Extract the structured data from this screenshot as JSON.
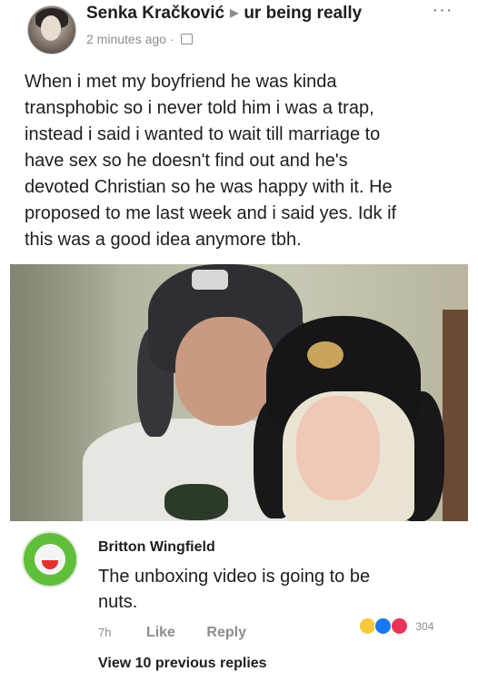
{
  "post": {
    "author": "Senka Kračković",
    "group": "ur being really",
    "time": "2 minutes ago",
    "more": "···",
    "text_lines": [
      "When i met my boyfriend he was kinda",
      "transphobic so i never told him i was a trap,",
      "instead i said i wanted to wait till marriage to",
      "have sex so he doesn't find out and he's",
      "devoted Christian so he was happy with it. He",
      "proposed to me last week  and i said yes. Idk if",
      "this was a good idea anymore tbh."
    ]
  },
  "comment": {
    "author": "Britton Wingfield",
    "text_lines": [
      "The unboxing video is going to be",
      "nuts."
    ],
    "time": "7h",
    "like_label": "Like",
    "reply_label": "Reply",
    "reaction_count": "304"
  },
  "view_replies": "View 10 previous replies",
  "colors": {
    "meta_gray": "#8a8d91",
    "text": "#1c1e21",
    "like_blue": "#1877f2",
    "love_red": "#e8345a",
    "haha_yellow": "#f7c93b"
  }
}
